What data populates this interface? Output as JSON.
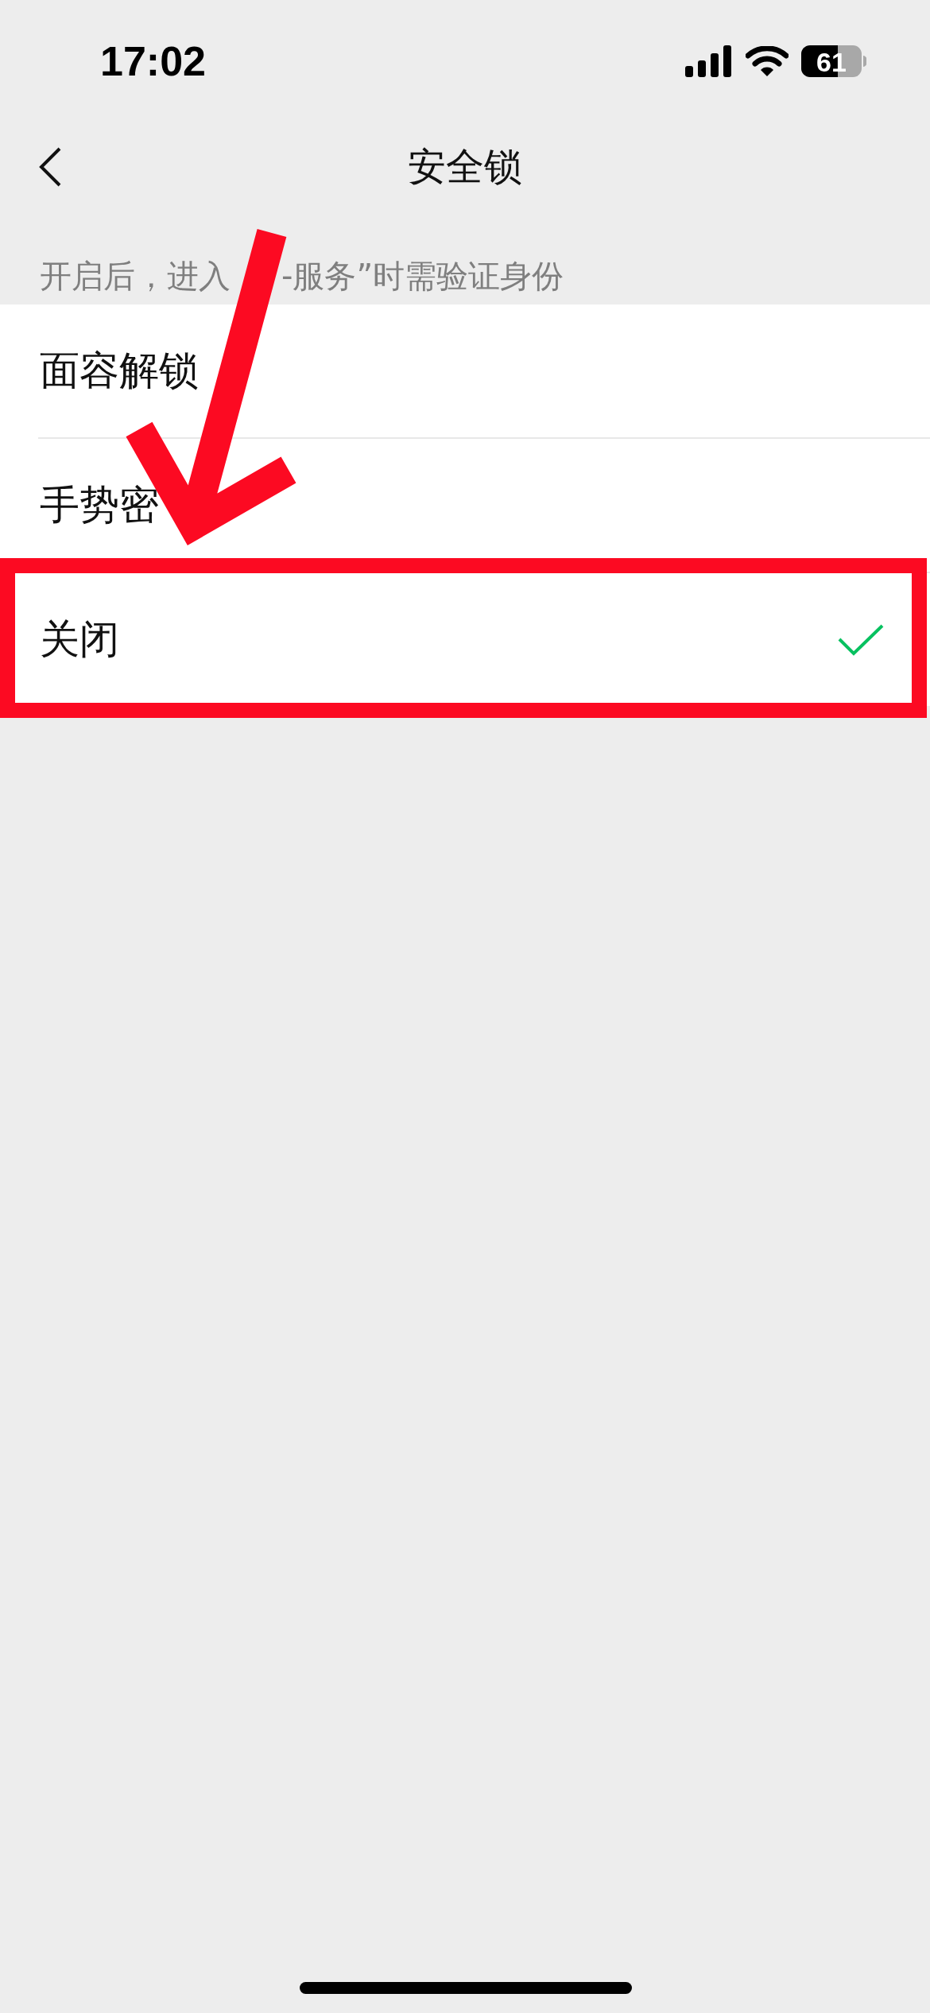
{
  "status_bar": {
    "time": "17:02",
    "battery": "61"
  },
  "nav_bar": {
    "title": "安全锁"
  },
  "hint": {
    "text_parts": [
      "开启后，进入",
      "-服务”时需验证身份"
    ]
  },
  "options": [
    {
      "label": "面容解锁",
      "selected": false,
      "highlighted": false
    },
    {
      "label": "手势密",
      "selected": false,
      "highlighted": false
    },
    {
      "label": "关闭",
      "selected": true,
      "highlighted": true
    }
  ],
  "annotations": [
    {
      "kind": "arrow"
    }
  ]
}
